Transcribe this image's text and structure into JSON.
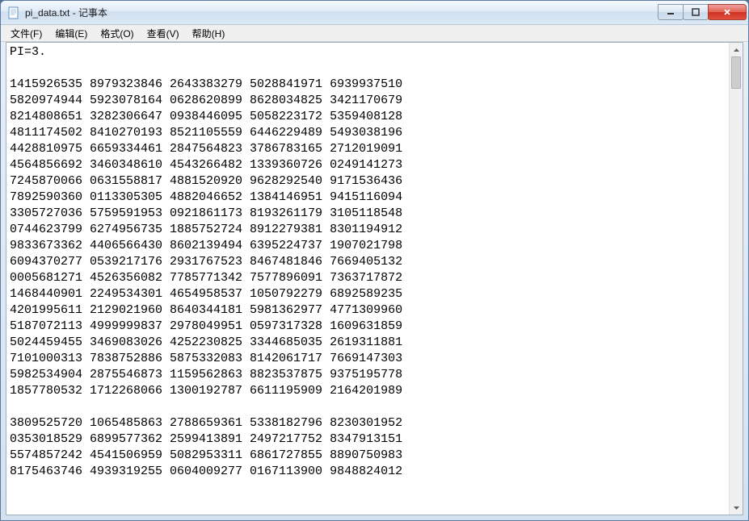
{
  "window": {
    "title": "pi_data.txt - 记事本"
  },
  "menu": {
    "file": "文件(F)",
    "edit": "编辑(E)",
    "format": "格式(O)",
    "view": "查看(V)",
    "help": "帮助(H)"
  },
  "content": {
    "text": "PI=3.\n\n1415926535 8979323846 2643383279 5028841971 6939937510\n5820974944 5923078164 0628620899 8628034825 3421170679\n8214808651 3282306647 0938446095 5058223172 5359408128\n4811174502 8410270193 8521105559 6446229489 5493038196\n4428810975 6659334461 2847564823 3786783165 2712019091\n4564856692 3460348610 4543266482 1339360726 0249141273\n7245870066 0631558817 4881520920 9628292540 9171536436\n7892590360 0113305305 4882046652 1384146951 9415116094\n3305727036 5759591953 0921861173 8193261179 3105118548\n0744623799 6274956735 1885752724 8912279381 8301194912\n9833673362 4406566430 8602139494 6395224737 1907021798\n6094370277 0539217176 2931767523 8467481846 7669405132\n0005681271 4526356082 7785771342 7577896091 7363717872\n1468440901 2249534301 4654958537 1050792279 6892589235\n4201995611 2129021960 8640344181 5981362977 4771309960\n5187072113 4999999837 2978049951 0597317328 1609631859\n5024459455 3469083026 4252230825 3344685035 2619311881\n7101000313 7838752886 5875332083 8142061717 7669147303\n5982534904 2875546873 1159562863 8823537875 9375195778\n1857780532 1712268066 1300192787 6611195909 2164201989\n\n3809525720 1065485863 2788659361 5338182796 8230301952\n0353018529 6899577362 2599413891 2497217752 8347913151\n5574857242 4541506959 5082953311 6861727855 8890750983\n8175463746 4939319255 0604009277 0167113900 9848824012"
  }
}
